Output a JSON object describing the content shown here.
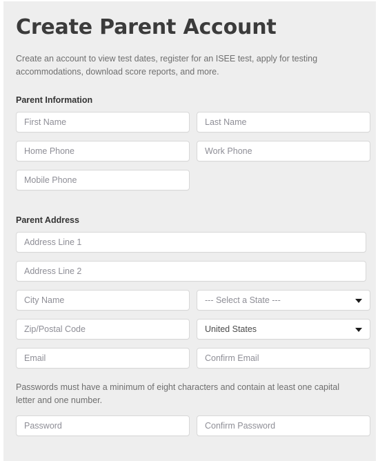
{
  "page": {
    "title": "Create Parent Account",
    "intro": "Create an account to view test dates, register for an ISEE test, apply for testing accommodations, download score reports, and more.",
    "background_color": "#eeeeee",
    "title_color": "#3b3b3b"
  },
  "sections": {
    "parent_information": {
      "label": "Parent Information",
      "fields": {
        "first_name": {
          "placeholder": "First Name",
          "value": ""
        },
        "last_name": {
          "placeholder": "Last Name",
          "value": ""
        },
        "home_phone": {
          "placeholder": "Home Phone",
          "value": ""
        },
        "work_phone": {
          "placeholder": "Work Phone",
          "value": ""
        },
        "mobile_phone": {
          "placeholder": "Mobile Phone",
          "value": ""
        }
      }
    },
    "parent_address": {
      "label": "Parent Address",
      "fields": {
        "address_line_1": {
          "placeholder": "Address Line 1",
          "value": ""
        },
        "address_line_2": {
          "placeholder": "Address Line 2",
          "value": ""
        },
        "city": {
          "placeholder": "City Name",
          "value": ""
        },
        "state": {
          "selected": "--- Select a State ---",
          "is_placeholder": true
        },
        "zip": {
          "placeholder": "Zip/Postal Code",
          "value": ""
        },
        "country": {
          "selected": "United States",
          "is_placeholder": false
        },
        "email": {
          "placeholder": "Email",
          "value": ""
        },
        "confirm_email": {
          "placeholder": "Confirm Email",
          "value": ""
        },
        "password": {
          "placeholder": "Password",
          "value": ""
        },
        "confirm_password": {
          "placeholder": "Confirm Password",
          "value": ""
        }
      },
      "password_note": "Passwords must have a minimum of eight characters and contain at least one capital letter and one number."
    }
  },
  "icons": {
    "dropdown": "chevron-down-icon"
  }
}
